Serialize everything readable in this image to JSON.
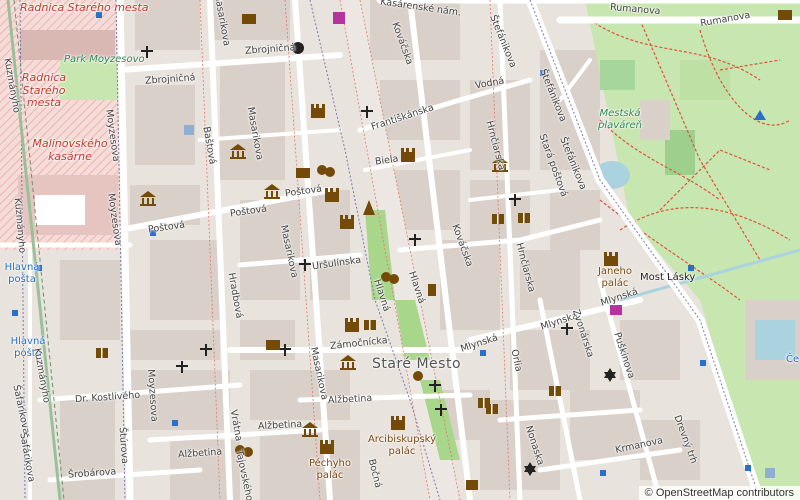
{
  "colors": {
    "background": "#f2efe9",
    "building": "#d9d0c9",
    "road_major": "#ffffff",
    "road_minor": "#ffffff",
    "park": "#c8e6b0",
    "park_path": "#e0523f",
    "military": "#f3d4d0",
    "water": "#aad3df",
    "railway": "#b0b0b0",
    "icon_brown": "#734a08",
    "icon_dark": "#222222"
  },
  "labels": {
    "radnica_stareho_1": "Radnica Starého mesta",
    "radnica_stareho_2": "Radnica Starého mesta",
    "park_moyzesovo": "Park Moyzesovo",
    "malinovskeho": "Malinovského kasárne",
    "hlavna_posta_1": "Hlavná pošta",
    "hlavna_posta_2": "Hlavná pošta",
    "mestska_plavaren": "Mestská plaváreň",
    "stare_mesto": "Staré Mesto",
    "janeho_palac": "Janeho palác",
    "arcibiskupsky_palac": "Arcibiskupský palác",
    "pechyho_palac": "Péchyho palác",
    "most_lasky": "Most Lásky"
  },
  "streets": {
    "kasarenske": "Kasárenské nám.",
    "rumanova_1": "Rumanova",
    "rumanova_2": "Rumanova",
    "zbrojnicna_1": "Zbrojničná",
    "zbrojnicna_2": "Zbrojničná",
    "masarikova_1": "Masarikova",
    "masarikova_2": "Masarikova",
    "masarikova_3": "Masarikova",
    "masarikova_4": "Masarikova",
    "moyzesova_1": "Moyzesova",
    "moyzesova_2": "Moyzesova",
    "moyzesova_3": "Moyzesova",
    "kovacska_1": "Kováčska",
    "kovacska_2": "Kováčska",
    "stefanikova_1": "Štefánikova",
    "stefanikova_2": "Štefánikova",
    "stefanikova_3": "Štefánikova",
    "vodna": "Vodná",
    "frantiskanska": "Františkánska",
    "hrnciarska_1": "Hrnčiarska",
    "hrnciarska_2": "Hrnčiarska",
    "stara_postova": "Stará poštová",
    "bastova": "Baštová",
    "biela": "Biela",
    "postova_1": "Poštová",
    "postova_2": "Poštová",
    "postova_3": "Poštová",
    "ursulinska": "Uršulínska",
    "hlavna_1": "Hlavná",
    "hlavna_2": "Hlavná",
    "hrađbova": "Hradbová",
    "zamocnicka": "Zámočnícka",
    "mlynska_1": "Mlynská",
    "mlynska_2": "Mlynská",
    "mlynska_3": "Mlynská",
    "orlia": "Orlia",
    "zvonarska": "Zvonárska",
    "puskinova": "Puškinova",
    "dr_kostliveho": "Dr. Kostlivého",
    "alzbetina_1": "Alžbetina",
    "alzbetina_2": "Alžbetina",
    "alzbetina_3": "Alžbetina",
    "vratna": "Vrátna",
    "srobarova": "Šrobárova",
    "bocna": "Bočná",
    "krmanova": "Krmanova",
    "dreveny": "Drevný trh",
    "nonaska": "Nonaska",
    "kuzmanyho_1": "Kuzmányho",
    "kuzmanyho_2": "Kuzmányho",
    "kuzmanyho_3": "Kuzmányho",
    "sturova": "Štúrova",
    "safarikova_1": "Šafárikova",
    "safarikova_2": "Šafárikova",
    "tajovska": "Tajovského",
    "ce": "Če"
  },
  "attribution": "© OpenStreetMap contributors"
}
